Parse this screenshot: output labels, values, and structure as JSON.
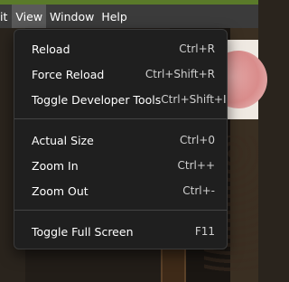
{
  "menubar": {
    "items": [
      {
        "label": "it"
      },
      {
        "label": "View"
      },
      {
        "label": "Window"
      },
      {
        "label": "Help"
      }
    ]
  },
  "menu": {
    "items": [
      {
        "label": "Reload",
        "shortcut": "Ctrl+R"
      },
      {
        "label": "Force Reload",
        "shortcut": "Ctrl+Shift+R"
      },
      {
        "label": "Toggle Developer Tools",
        "shortcut": "Ctrl+Shift+I"
      },
      {
        "label": "Actual Size",
        "shortcut": "Ctrl+0"
      },
      {
        "label": "Zoom In",
        "shortcut": "Ctrl++"
      },
      {
        "label": "Zoom Out",
        "shortcut": "Ctrl+-"
      },
      {
        "label": "Toggle Full Screen",
        "shortcut": "F11"
      }
    ]
  },
  "colors": {
    "menu_bg": "#1f1f1f",
    "menubar_bg": "#3b3b3b",
    "active_menu": "#5a5a5a",
    "accent_strip": "#5a7a2a"
  }
}
